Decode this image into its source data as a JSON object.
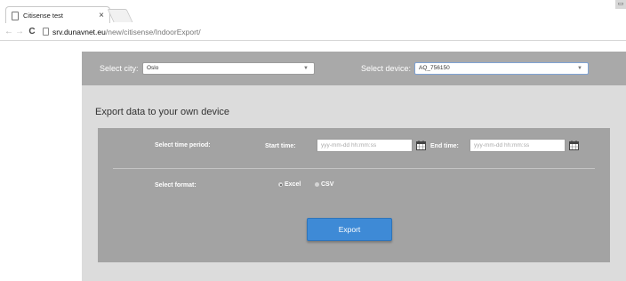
{
  "browser": {
    "tab_title": "Citisense test",
    "tab_close": "×",
    "url_host": "srv.dunavnet.eu",
    "url_path": "/new/citisense/IndoorExport/"
  },
  "city_bar": {
    "city_label": "Select city:",
    "city_value": "Oslo",
    "device_label": "Select device:",
    "device_value": "AQ_756150",
    "background": "#a9a9a9"
  },
  "export": {
    "title": "Export data to your own device",
    "time_period_label": "Select time period:",
    "start_label": "Start time:",
    "start_placeholder": "yyy-mm-dd hh:mm:ss",
    "end_label": "End time:",
    "end_placeholder": "yyy-mm-dd hh:mm:ss",
    "format_label": "Select format:",
    "formats": [
      {
        "label": "Excel",
        "selected": true
      },
      {
        "label": "CSV",
        "selected": false
      }
    ],
    "button_label": "Export",
    "button_color": "#3e8ad6",
    "panel_color": "#a3a3a3"
  }
}
